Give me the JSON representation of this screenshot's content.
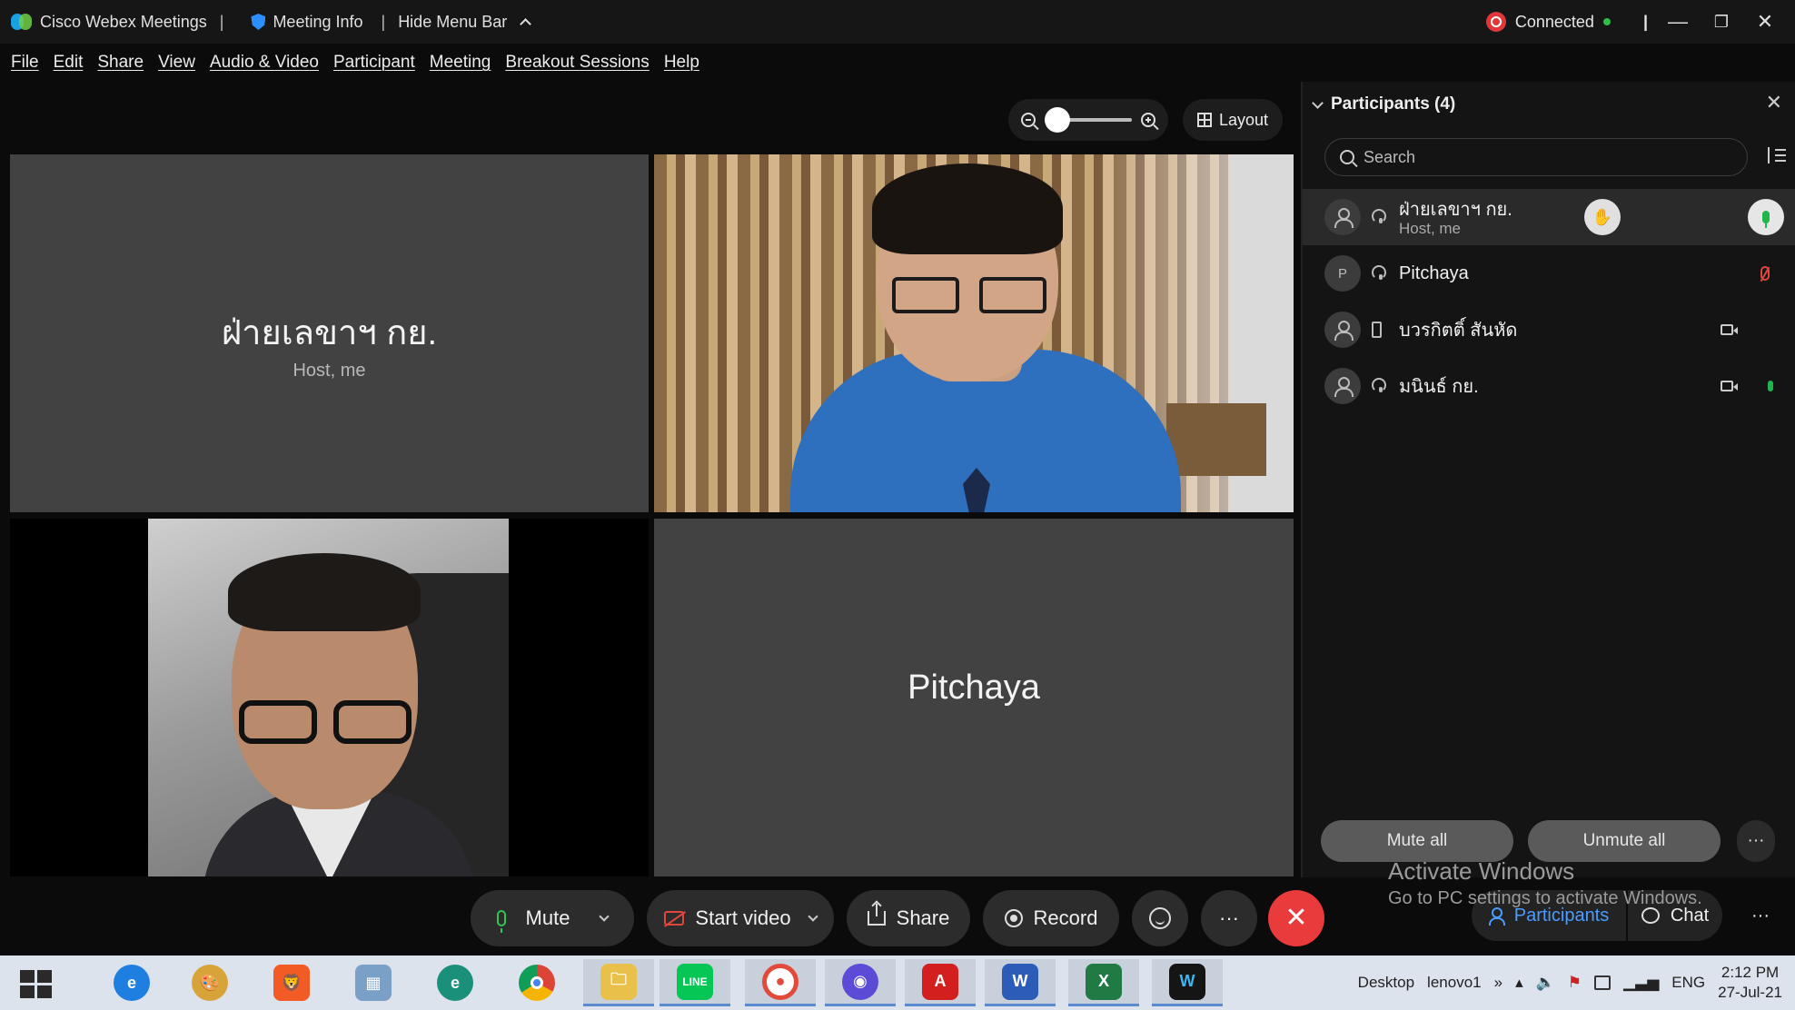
{
  "titlebar": {
    "app_name": "Cisco Webex Meetings",
    "sep1": "|",
    "meeting_info": "Meeting Info",
    "sep2": "|",
    "hide_menu": "Hide Menu Bar",
    "status": "Connected",
    "sep3": "|"
  },
  "menu": [
    "File",
    "Edit",
    "Share",
    "View",
    "Audio & Video",
    "Participant",
    "Meeting",
    "Breakout Sessions",
    "Help"
  ],
  "toolbar": {
    "layout_label": "Layout",
    "zoom_level": 0.0
  },
  "tiles": [
    {
      "name": "ฝ่ายเลขาฯ กย.",
      "role": "Host, me"
    },
    {
      "name": "Pitchaya"
    }
  ],
  "participants": {
    "title": "Participants (4)",
    "search_placeholder": "Search",
    "items": [
      {
        "name": "ฝ่ายเลขาฯ กย.",
        "sub": "Host, me",
        "avatar": "person-icon",
        "audio": "headset-icon",
        "mic": "unmuted"
      },
      {
        "name": "Pitchaya",
        "avatar_letter": "P",
        "audio": "headset-icon",
        "mic": "muted"
      },
      {
        "name": "บวรกิตติ์ สันหัด",
        "avatar": "person-icon",
        "audio": "phone-icon",
        "video": "camera-icon"
      },
      {
        "name": "มนินธ์ กย.",
        "avatar": "person-icon",
        "audio": "headset-icon",
        "video": "camera-icon",
        "mic": "unmuted"
      }
    ],
    "mute_all": "Mute all",
    "unmute_all": "Unmute all",
    "more": "···"
  },
  "watermark": {
    "line1": "Activate Windows",
    "line2": "Go to PC settings to activate Windows."
  },
  "controls": {
    "mute": "Mute",
    "start_video": "Start video",
    "share": "Share",
    "record": "Record",
    "more": "···",
    "participants_tab": "Participants",
    "chat_tab": "Chat",
    "panel_more": "···"
  },
  "taskbar": {
    "desktop": "Desktop",
    "user": "lenovo1",
    "chevron": "»",
    "lang": "ENG",
    "time": "2:12 PM",
    "date": "27-Jul-21",
    "apps": [
      "ie",
      "paint",
      "brave",
      "calculator",
      "edge",
      "chrome",
      "file-explorer",
      "line",
      "vpn",
      "firefox",
      "acrobat",
      "word",
      "excel",
      "webex"
    ]
  },
  "colors": {
    "accent": "#4a9cff",
    "leave": "#e93a3c",
    "mic_on": "#2fc655",
    "mic_off": "#e0463b"
  }
}
